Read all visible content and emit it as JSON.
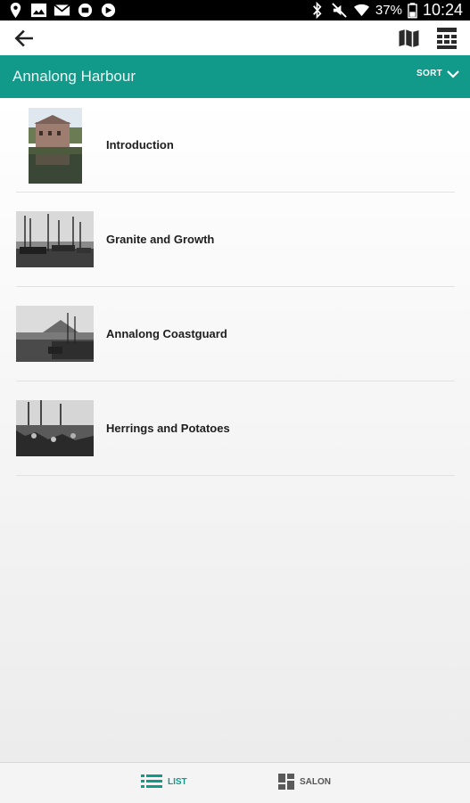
{
  "status_bar": {
    "battery_pct": "37%",
    "time": "10:24",
    "icons": [
      "location-icon",
      "photo-icon",
      "mail-icon",
      "app-icon",
      "app-icon",
      "bluetooth-icon",
      "mute-icon",
      "wifi-icon",
      "battery-icon"
    ]
  },
  "toolbar": {
    "back_icon": "arrow-left-icon",
    "map_icon": "map-icon",
    "grid_icon": "view-grid-icon"
  },
  "header": {
    "title": "Annalong Harbour",
    "sort_label": "SORT"
  },
  "items": [
    {
      "label": "Introduction"
    },
    {
      "label": "Granite and Growth"
    },
    {
      "label": "Annalong Coastguard"
    },
    {
      "label": "Herrings and Potatoes"
    }
  ],
  "bottom_tabs": [
    {
      "label": "LIST",
      "active": true
    },
    {
      "label": "SALON",
      "active": false
    }
  ],
  "colors": {
    "accent": "#119a8a",
    "text": "#1e1e1e",
    "inactive_tab": "#555555"
  }
}
